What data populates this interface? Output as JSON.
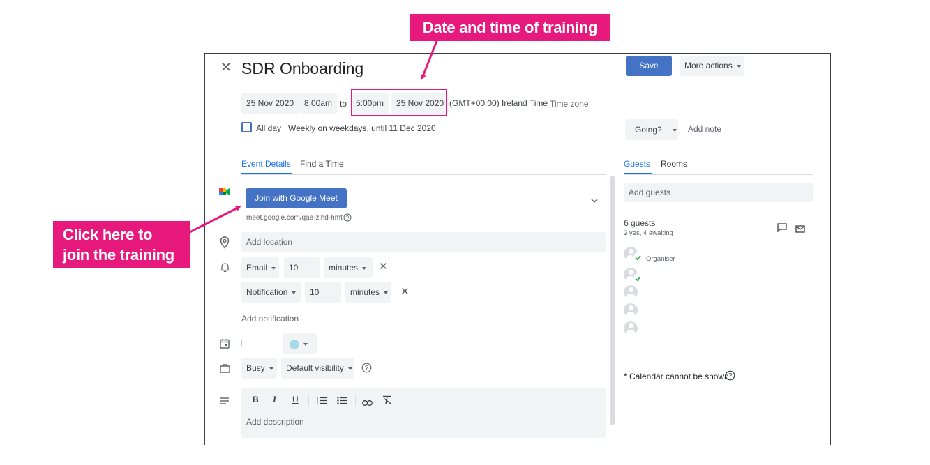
{
  "annotations": {
    "top_callout": "Date and time of training",
    "left_callout_line1": "Click here to",
    "left_callout_line2": "join the training",
    "accent_color": "#e8197d"
  },
  "event": {
    "title": "SDR Onboarding",
    "start_date": "25 Nov 2020",
    "start_time": "8:00am",
    "to_label": "to",
    "end_time": "5:00pm",
    "end_date": "25 Nov 2020",
    "timezone_text": "(GMT+00:00) Ireland Time",
    "timezone_button": "Time zone",
    "all_day_label": "All day",
    "recurrence": "Weekly on weekdays, until 11 Dec 2020"
  },
  "toolbar": {
    "save_label": "Save",
    "more_actions_label": "More actions",
    "primary_color": "#4472c4"
  },
  "rsvp": {
    "going_label": "Going?",
    "add_note_label": "Add note"
  },
  "tabs": {
    "event_details": "Event Details",
    "find_a_time": "Find a Time"
  },
  "conference": {
    "join_label": "Join with Google Meet",
    "link": "meet.google.com/qae-zihd-hmt"
  },
  "location": {
    "placeholder": "Add location"
  },
  "notifications": [
    {
      "type": "Email",
      "value": "10",
      "unit": "minutes"
    },
    {
      "type": "Notification",
      "value": "10",
      "unit": "minutes"
    }
  ],
  "add_notification_label": "Add notification",
  "calendar": {
    "color": "#a5dbe8"
  },
  "availability": {
    "status": "Busy",
    "visibility": "Default visibility"
  },
  "description": {
    "placeholder": "Add description"
  },
  "guests_panel": {
    "tab_guests": "Guests",
    "tab_rooms": "Rooms",
    "add_guests_placeholder": "Add guests",
    "count": "6 guests",
    "summary": "2 yes, 4 awaiting",
    "organiser_label": "Organiser",
    "calendar_note": "* Calendar cannot be shown"
  }
}
